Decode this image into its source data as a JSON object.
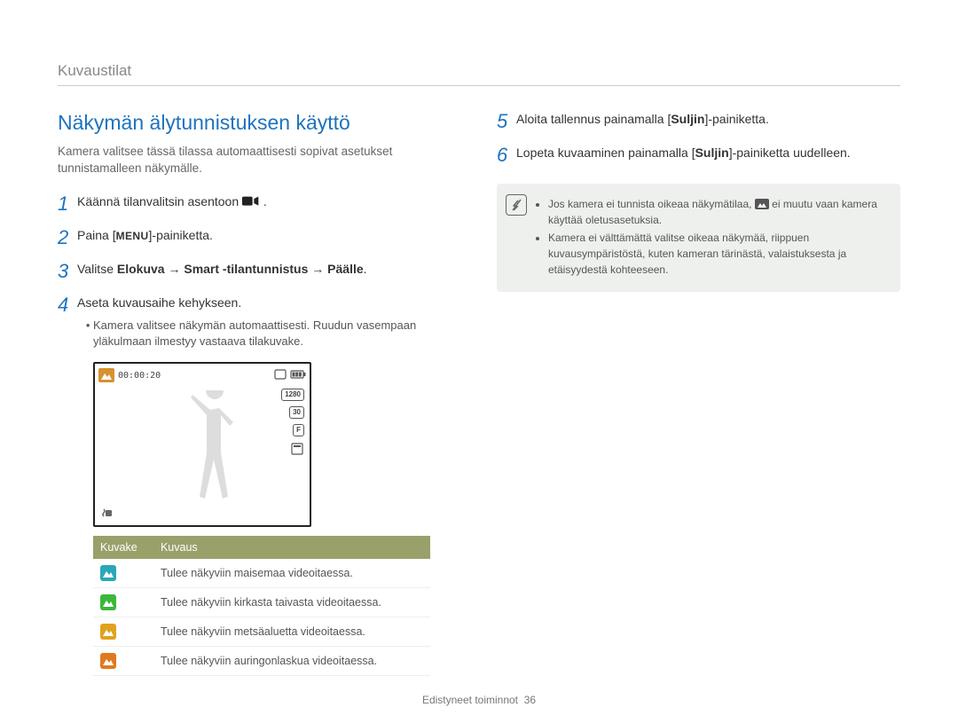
{
  "breadcrumb": "Kuvaustilat",
  "section_title": "Näkymän älytunnistuksen käyttö",
  "intro": "Kamera valitsee tässä tilassa automaattisesti sopivat asetukset tunnistamalleen näkymälle.",
  "steps_left": {
    "s1": {
      "num": "1",
      "pre": "Käännä tilanvalitsin asentoon ",
      "icon": "video-icon",
      "post": "."
    },
    "s2": {
      "num": "2",
      "pre": "Paina [",
      "menu": "MENU",
      "post": "]-painiketta."
    },
    "s3": {
      "num": "3",
      "pre": "Valitse ",
      "b1": "Elokuva",
      "arrow1": " → ",
      "b2": "Smart -tilantunnistus",
      "arrow2": " → ",
      "b3": "Päälle",
      "post": "."
    },
    "s4": {
      "num": "4",
      "text": "Aseta kuvausaihe kehykseen.",
      "bullet": "Kamera valitsee näkymän automaattisesti. Ruudun vasempaan yläkulmaan ilmestyy vastaava tilakuvake."
    }
  },
  "steps_right": {
    "s5": {
      "num": "5",
      "pre": "Aloita tallennus painamalla [",
      "b": "Suljin",
      "post": "]-painiketta."
    },
    "s6": {
      "num": "6",
      "pre": "Lopeta kuvaaminen painamalla [",
      "b": "Suljin",
      "post": "]-painiketta uudelleen."
    }
  },
  "notes": {
    "n1_pre": "Jos kamera ei tunnista oikeaa näkymätilaa, ",
    "n1_post": " ei muutu vaan kamera käyttää oletusasetuksia.",
    "n2": "Kamera ei välttämättä valitse oikeaa näkymää, riippuen kuvausympäristöstä, kuten kameran tärinästä, valaistuksesta ja etäisyydestä kohteeseen."
  },
  "lcd": {
    "time": "00:00:20",
    "size": "1280",
    "fps": "30",
    "focus": "F"
  },
  "table": {
    "head_icon": "Kuvake",
    "head_desc": "Kuvaus",
    "rows": [
      {
        "color": "#2aa7b8",
        "desc": "Tulee näkyviin maisemaa videoitaessa."
      },
      {
        "color": "#3bb83b",
        "desc": "Tulee näkyviin kirkasta taivasta videoitaessa."
      },
      {
        "color": "#e0a21e",
        "desc": "Tulee näkyviin metsäaluetta videoitaessa."
      },
      {
        "color": "#e07a1e",
        "desc": "Tulee näkyviin auringonlaskua videoitaessa."
      }
    ]
  },
  "footer": {
    "label": "Edistyneet toiminnot",
    "page": "36"
  }
}
